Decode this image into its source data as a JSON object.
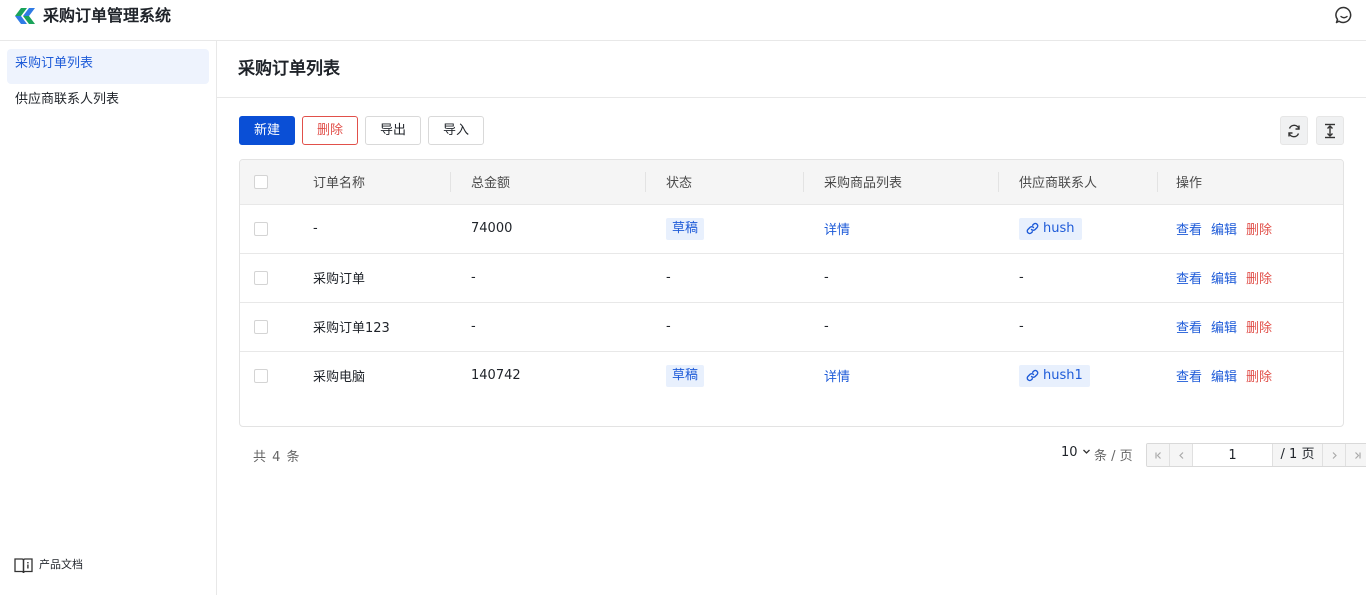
{
  "app": {
    "title": "采购订单管理系统"
  },
  "sidebar": {
    "items": [
      {
        "label": "采购订单列表",
        "active": true
      },
      {
        "label": "供应商联系人列表",
        "active": false
      }
    ],
    "doc_label": "产品文档"
  },
  "page": {
    "title": "采购订单列表"
  },
  "toolbar": {
    "new_label": "新建",
    "delete_label": "删除",
    "export_label": "导出",
    "import_label": "导入"
  },
  "table": {
    "columns": [
      "订单名称",
      "总金额",
      "状态",
      "采购商品列表",
      "供应商联系人",
      "操作"
    ],
    "rows": [
      {
        "name": "-",
        "amount": "74000",
        "status": "草稿",
        "items": "详情",
        "contact": "hush"
      },
      {
        "name": "采购订单",
        "amount": "-",
        "status": "-",
        "items": "-",
        "contact": "-"
      },
      {
        "name": "采购订单123",
        "amount": "-",
        "status": "-",
        "items": "-",
        "contact": "-"
      },
      {
        "name": "采购电脑",
        "amount": "140742",
        "status": "草稿",
        "items": "详情",
        "contact": "hush1"
      }
    ],
    "actions": {
      "view": "查看",
      "edit": "编辑",
      "delete": "删除"
    }
  },
  "pagination": {
    "total_text": "共 4 条",
    "page_size": "10",
    "page_size_unit": "条 / 页",
    "current_page": "1",
    "total_pages_text": "/ 1 页"
  },
  "colors": {
    "primary": "#0a4fd6",
    "danger": "#e1504a",
    "link": "#1e5bd8",
    "active_bg": "#eef3fd"
  }
}
